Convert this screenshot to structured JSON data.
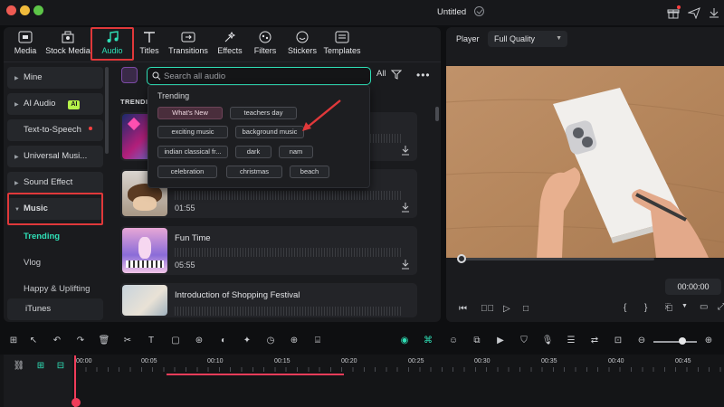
{
  "window": {
    "title": "Untitled"
  },
  "tabs": [
    {
      "label": "Media",
      "icon": "media-icon"
    },
    {
      "label": "Stock Media",
      "icon": "stock-media-icon"
    },
    {
      "label": "Audio",
      "icon": "music-note-icon",
      "active": true
    },
    {
      "label": "Titles",
      "icon": "titles-icon"
    },
    {
      "label": "Transitions",
      "icon": "transitions-icon"
    },
    {
      "label": "Effects",
      "icon": "effects-icon"
    },
    {
      "label": "Filters",
      "icon": "filters-icon"
    },
    {
      "label": "Stickers",
      "icon": "stickers-icon"
    },
    {
      "label": "Templates",
      "icon": "templates-icon"
    }
  ],
  "sidebar": {
    "items": [
      {
        "label": "Mine"
      },
      {
        "label": "AI Audio",
        "badge": "AI"
      },
      {
        "label": "Text-to-Speech"
      },
      {
        "label": "Universal Musi..."
      },
      {
        "label": "Sound Effect"
      },
      {
        "label": "Music",
        "expanded": true
      }
    ],
    "subitems": [
      {
        "label": "Trending",
        "active": true
      },
      {
        "label": "Vlog"
      },
      {
        "label": "Happy & Uplifting"
      },
      {
        "label": "iTunes"
      }
    ]
  },
  "search": {
    "placeholder": "Search all audio",
    "filter_label": "All"
  },
  "list": {
    "section_label": "TRENDIN",
    "tracks": [
      {
        "title": "",
        "duration": ""
      },
      {
        "title": "",
        "duration": "01:55"
      },
      {
        "title": "Fun Time",
        "duration": "05:55"
      },
      {
        "title": "Introduction of Shopping Festival",
        "duration": ""
      }
    ]
  },
  "dropdown": {
    "title": "Trending",
    "chips": [
      "What's New",
      "teachers day",
      "exciting music",
      "background music",
      "indian classical fr...",
      "dark",
      "nam",
      "celebration",
      "christmas",
      "beach"
    ]
  },
  "player": {
    "label": "Player",
    "quality": "Full Quality",
    "timecode": "00:00:00"
  },
  "ruler": [
    "00:00",
    "00:05",
    "00:10",
    "00:15",
    "00:20",
    "00:25",
    "00:30",
    "00:35",
    "00:40",
    "00:45"
  ],
  "colors": {
    "accent": "#2fe0b7",
    "highlight": "#e0383a",
    "playhead": "#f03c5a"
  }
}
